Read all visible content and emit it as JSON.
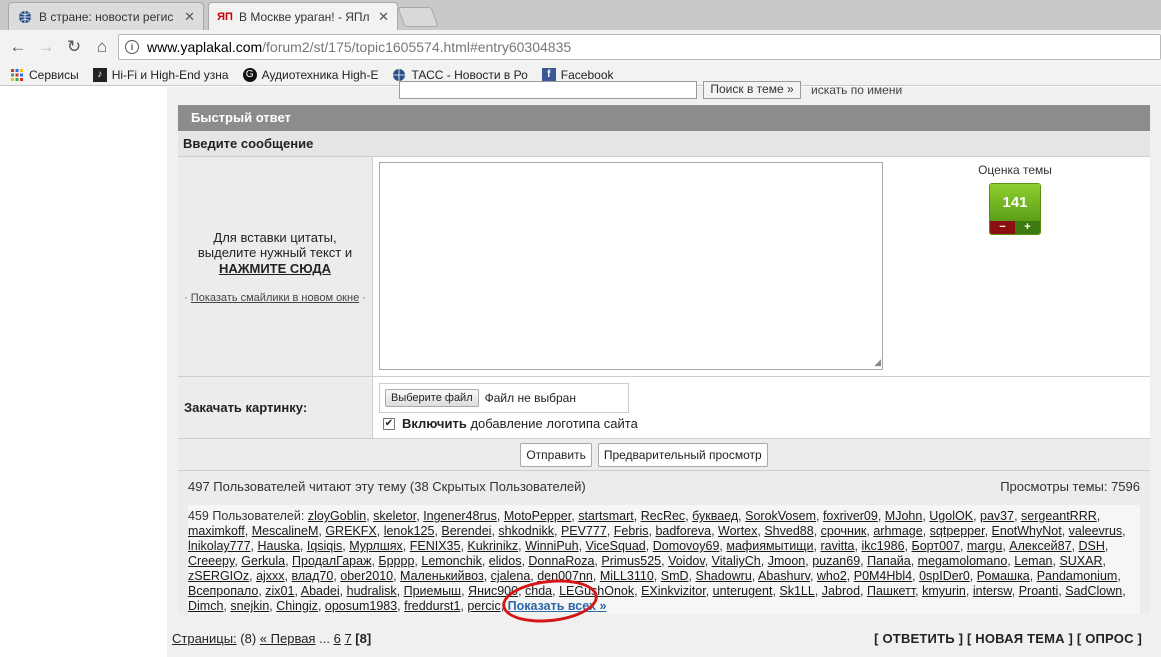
{
  "tabs": [
    {
      "title": "В стране: новости регис",
      "favicon": "globe-icon",
      "active": false
    },
    {
      "title": "В Москве ураган! - ЯПл",
      "favicon": "yaplakal-icon",
      "active": true
    }
  ],
  "toolbar": {
    "url_host": "www.yaplakal.com",
    "url_path": "/forum2/st/175/topic1605574.html#entry60304835"
  },
  "bookmarks": [
    {
      "label": "Сервисы",
      "icon": "apps-icon"
    },
    {
      "label": "Hi-Fi и High-End узна",
      "icon": "music-icon"
    },
    {
      "label": "Аудиотехника High-E",
      "icon": "g-icon"
    },
    {
      "label": "ТАСС - Новости в Ро",
      "icon": "tass-icon"
    },
    {
      "label": "Facebook",
      "icon": "facebook-icon"
    }
  ],
  "top": {
    "search_btn": "Поиск в теме »",
    "search_check": "искать по имени"
  },
  "form": {
    "quick_reply": "Быстрый ответ",
    "enter_message": "Введите сообщение",
    "quote_line1": "Для вставки цитаты,",
    "quote_line2": "выделите нужный текст и",
    "quote_link": "НАЖМИТЕ СЮДА",
    "smilies_prefix": "·",
    "smilies_link": "Показать смайлики в новом окне",
    "smilies_suffix": "·",
    "rating_label": "Оценка темы",
    "rating_value": "141",
    "rating_minus": "−",
    "rating_plus": "+",
    "upload_label": "Закачать картинку:",
    "file_button": "Выберите файл",
    "file_status": "Файл не выбран",
    "logo_bold": "Включить",
    "logo_rest": " добавление логотипа сайта",
    "submit": "Отправить",
    "preview": "Предварительный просмотр"
  },
  "readers": {
    "summary": "497 Пользователей читают эту тему (38 Скрытых Пользователей)",
    "views": "Просмотры темы: 7596",
    "count_label": "459 Пользователей:",
    "users": [
      "zloyGoblin",
      "skeletor",
      "Ingener48rus",
      "MotoPepper",
      "startsmart",
      "RecRec",
      "букваед",
      "SorokVosem",
      "foxriver09",
      "MJohn",
      "UgolOK",
      "pav37",
      "sergeantRRR",
      "maximkoff",
      "MescalineM",
      "GREKFX",
      "lenok125",
      "Berendei",
      "shkodnikk",
      "PEV777",
      "Febris",
      "badforeva",
      "Wortex",
      "Shved88",
      "срочник",
      "arhmage",
      "sqtpepper",
      "EnotWhyNot",
      "valeevrus",
      "lnikolay777",
      "Hauska",
      "Iqsiqis",
      "Мурлшях",
      "FENIX35",
      "Kukrinikz",
      "WinniPuh",
      "ViceSquad",
      "Domovoy69",
      "мафиямытищи",
      "ravitta",
      "ikc1986",
      "Борт007",
      "margu",
      "Алексей87",
      "DSH",
      "Creeepy",
      "Gerkula",
      "ПродалГараж",
      "Бpppp",
      "Lemonchik",
      "elidos",
      "DonnaRoza",
      "Primus525",
      "Voidov",
      "VitaliyCh",
      "Jmoon",
      "puzan69",
      "Папайа",
      "megamolomano",
      "Leman",
      "SUXAR",
      "zSERGIOz",
      "ajxxx",
      "влад70",
      "ober2010",
      "Маленькийвоз",
      "cjalena",
      "den007nn",
      "MiLL3110",
      "SmD",
      "Shadowru",
      "Abashurv",
      "who2",
      "P0M4Hbl4",
      "0spIDer0",
      "Ромашка",
      "Pandamonium",
      "Всепропало",
      "zix01",
      "Abadei",
      "hudralisk",
      "Приемыш",
      "Янис900",
      "chda",
      "LEGushOnok",
      "EXinkvizitor",
      "unterugent",
      "Sk1LL",
      "Jabrod",
      "Пашкетт",
      "kmyurin",
      "intersw",
      "Proanti",
      "SadClown",
      "Dimch",
      "snejkin",
      "Chingiz",
      "oposum1983",
      "freddurst1",
      "percic"
    ],
    "show_all": "Показать всех »"
  },
  "pager": {
    "label": "Страницы:",
    "count": "(8)",
    "first": "« Первая",
    "dots": "...",
    "p6": "6",
    "p7": "7",
    "current": "[8]",
    "reply": "[ ОТВЕТИТЬ ]",
    "new_topic": "[ НОВАЯ ТЕМА ]",
    "poll": "[ ОПРОС ]"
  },
  "colors": {
    "header_bg": "#8c8c8c",
    "rating_green": "#6fb320",
    "highlight_circle": "#d51616",
    "show_all_link": "#2a66a8"
  }
}
